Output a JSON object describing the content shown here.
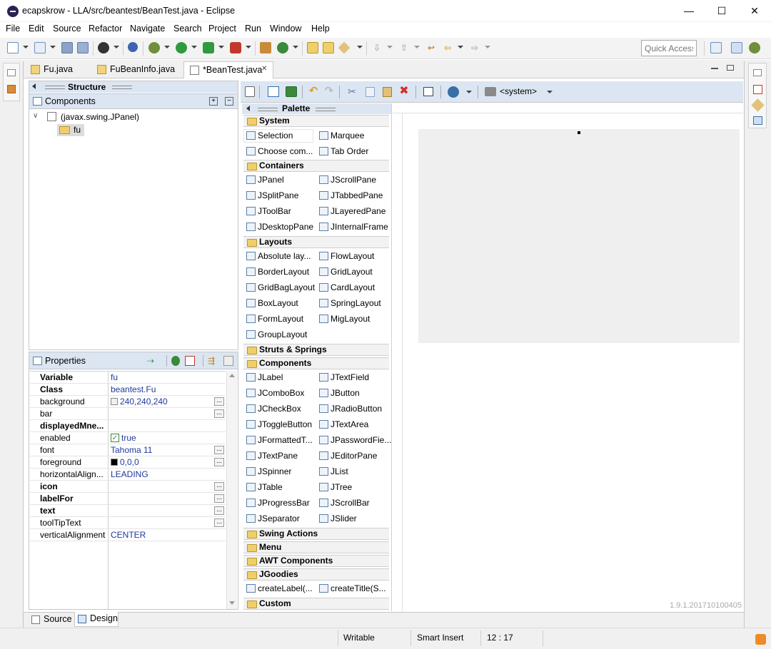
{
  "window": {
    "title": "ecapskrow - LLA/src/beantest/BeanTest.java - Eclipse",
    "minimize": "—",
    "maximize": "☐",
    "close": "✕"
  },
  "menu": [
    "File",
    "Edit",
    "Source",
    "Refactor",
    "Navigate",
    "Search",
    "Project",
    "Run",
    "Window",
    "Help"
  ],
  "toolbar": {
    "quick_access_placeholder": "Quick Access"
  },
  "editor_tabs": [
    {
      "label": "Fu.java",
      "active": false
    },
    {
      "label": "FuBeanInfo.java",
      "active": false
    },
    {
      "label": "*BeanTest.java",
      "active": true,
      "close": "✕"
    }
  ],
  "structure": {
    "title": "Structure",
    "components_title": "Components",
    "tree": [
      {
        "label": "(javax.swing.JPanel)",
        "expander": "∨"
      },
      {
        "label": "fu"
      }
    ]
  },
  "properties": {
    "title": "Properties",
    "rows": [
      {
        "name": "Variable",
        "value": "fu",
        "bold": true,
        "dots": false
      },
      {
        "name": "Class",
        "value": "beantest.Fu",
        "bold": true,
        "dots": false
      },
      {
        "name": "background",
        "value": "240,240,240",
        "bold": false,
        "dots": true,
        "swatch": "#f0f0f0"
      },
      {
        "name": "bar",
        "value": "",
        "bold": false,
        "dots": true
      },
      {
        "name": "displayedMne...",
        "value": "",
        "bold": true,
        "dots": false
      },
      {
        "name": "enabled",
        "value": "true",
        "bold": false,
        "dots": false,
        "check": true
      },
      {
        "name": "font",
        "value": "Tahoma 11",
        "bold": false,
        "dots": true
      },
      {
        "name": "foreground",
        "value": "0,0,0",
        "bold": false,
        "dots": true,
        "swatch": "#000000"
      },
      {
        "name": "horizontalAlign...",
        "value": "LEADING",
        "bold": false,
        "dots": false
      },
      {
        "name": "icon",
        "value": "",
        "bold": true,
        "dots": true
      },
      {
        "name": "labelFor",
        "value": "",
        "bold": true,
        "dots": true
      },
      {
        "name": "text",
        "value": "",
        "bold": true,
        "dots": true
      },
      {
        "name": "toolTipText",
        "value": "",
        "bold": false,
        "dots": true
      },
      {
        "name": "verticalAlignment",
        "value": "CENTER",
        "bold": false,
        "dots": false
      }
    ]
  },
  "designer_toolbar": {
    "system_label": "<system>"
  },
  "palette": {
    "title": "Palette",
    "categories": {
      "system": "System",
      "containers": "Containers",
      "layouts": "Layouts",
      "struts": "Struts & Springs",
      "components": "Components",
      "swing_actions": "Swing Actions",
      "menu": "Menu",
      "awt": "AWT Components",
      "jgoodies": "JGoodies",
      "custom": "Custom"
    },
    "system_items": [
      "Selection",
      "Marquee",
      "Choose com...",
      "Tab Order"
    ],
    "container_items": [
      "JPanel",
      "JScrollPane",
      "JSplitPane",
      "JTabbedPane",
      "JToolBar",
      "JLayeredPane",
      "JDesktopPane",
      "JInternalFrame"
    ],
    "layout_items": [
      "Absolute lay...",
      "FlowLayout",
      "BorderLayout",
      "GridLayout",
      "GridBagLayout",
      "CardLayout",
      "BoxLayout",
      "SpringLayout",
      "FormLayout",
      "MigLayout",
      "GroupLayout"
    ],
    "component_items": [
      "JLabel",
      "JTextField",
      "JComboBox",
      "JButton",
      "JCheckBox",
      "JRadioButton",
      "JToggleButton",
      "JTextArea",
      "JFormattedT...",
      "JPasswordFie...",
      "JTextPane",
      "JEditorPane",
      "JSpinner",
      "JList",
      "JTable",
      "JTree",
      "JProgressBar",
      "JScrollBar",
      "JSeparator",
      "JSlider"
    ],
    "jgoodies_items": [
      "createLabel(...",
      "createTitle(S..."
    ]
  },
  "design": {
    "version": "1.9.1.201710100405"
  },
  "bottom_tabs": [
    {
      "label": "Source",
      "active": false
    },
    {
      "label": "Design",
      "active": true
    }
  ],
  "status": {
    "writable": "Writable",
    "insert_mode": "Smart Insert",
    "position": "12 : 17"
  }
}
